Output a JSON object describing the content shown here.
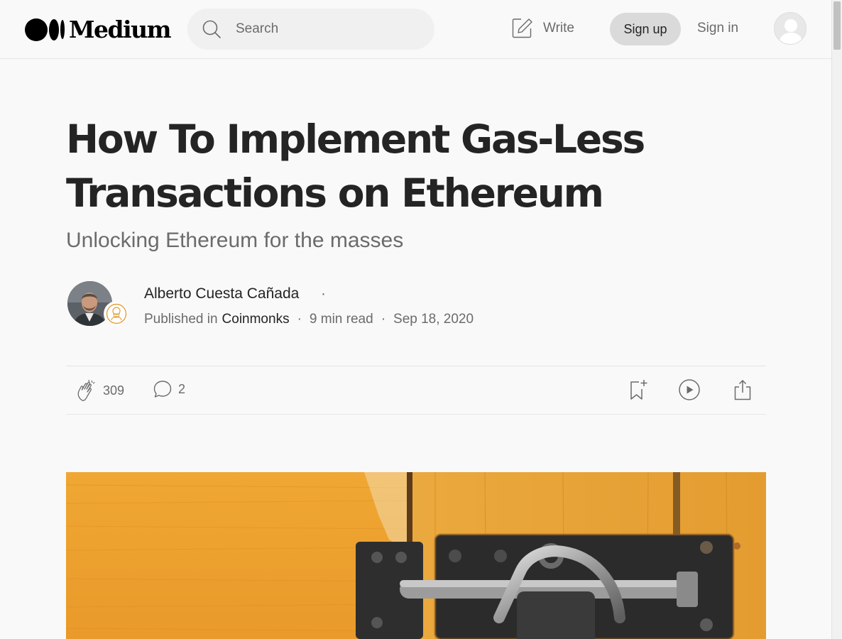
{
  "header": {
    "logo_text": "Medium",
    "search_placeholder": "Search",
    "write_label": "Write",
    "signup_label": "Sign up",
    "signin_label": "Sign in"
  },
  "article": {
    "title": "How To Implement Gas-Less Transactions on Ethereum",
    "subtitle": "Unlocking Ethereum for the masses",
    "author": "Alberto Cuesta Cañada",
    "author_sep": "·",
    "published_in_prefix": "Published in",
    "publication": "Coinmonks",
    "read_time": "9 min read",
    "date": "Sep 18, 2020",
    "meta_sep": "·"
  },
  "actions": {
    "claps": "309",
    "comments": "2"
  },
  "icons": {
    "search": "search-icon",
    "write": "write-icon",
    "clap": "clap-icon",
    "comment": "comment-icon",
    "bookmark": "bookmark-add-icon",
    "listen": "play-icon",
    "share": "share-icon"
  },
  "colors": {
    "background": "#f9f9f9",
    "text_primary": "#242424",
    "text_secondary": "#6b6b6b",
    "signup_bg": "#dadada",
    "search_bg": "#f0f0f0",
    "hero_wood": "#e9a43a"
  }
}
